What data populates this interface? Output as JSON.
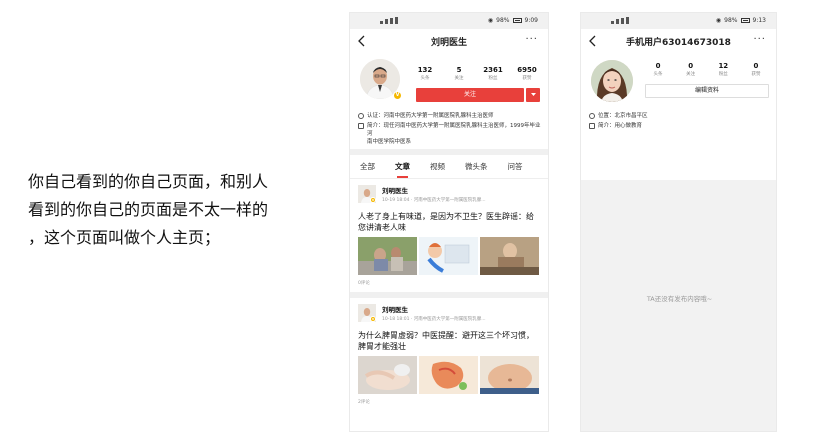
{
  "caption": {
    "line1": "你自己看到的你自己页面，和别人",
    "line2": "看到的你自己的页面是不太一样的",
    "line3": "，这个页面叫做个人主页；"
  },
  "phone1": {
    "status": {
      "right_text": "98%",
      "time": "9:09"
    },
    "nav": {
      "title": "刘明医生",
      "more": "···"
    },
    "stats": [
      {
        "num": "132",
        "label": "头条"
      },
      {
        "num": "5",
        "label": "关注"
      },
      {
        "num": "2361",
        "label": "粉丝"
      },
      {
        "num": "6950",
        "label": "获赞"
      }
    ],
    "follow_label": "关注",
    "verify_text": "认证：河南中医药大学第一附属医院乳腺科主治医师",
    "intro_text_1": "简介：现任河南中医药大学第一附属医院乳腺科主治医师，1999年毕业河",
    "intro_text_2": "南中医学院中医系",
    "tabs": [
      "全部",
      "文章",
      "视频",
      "微头条",
      "问答"
    ],
    "posts": [
      {
        "author": "刘明医生",
        "sub": "10-19 18:04 · 河南中医药大学第一附属医院乳腺...",
        "title": "人老了身上有味道，是因为不卫生？医生辟谣：给您讲清老人味",
        "comments": "0评论"
      },
      {
        "author": "刘明医生",
        "sub": "10-18 18:01 · 河南中医药大学第一附属医院乳腺...",
        "title": "为什么脾胃虚弱？中医提醒：避开这三个坏习惯，脾胃才能强壮",
        "comments": "2评论"
      }
    ],
    "accent": "#e8403b"
  },
  "phone2": {
    "status": {
      "right_text": "98%",
      "time": "9:13"
    },
    "nav": {
      "title": "手机用户63014673018",
      "more": "···"
    },
    "stats": [
      {
        "num": "0",
        "label": "头条"
      },
      {
        "num": "0",
        "label": "关注"
      },
      {
        "num": "12",
        "label": "粉丝"
      },
      {
        "num": "0",
        "label": "获赞"
      }
    ],
    "edit_label": "编辑资料",
    "location_text": "位置：北京市昌平区",
    "intro_text": "简介：用心做教育",
    "empty_text": "TA还没有发布内容哦~"
  }
}
